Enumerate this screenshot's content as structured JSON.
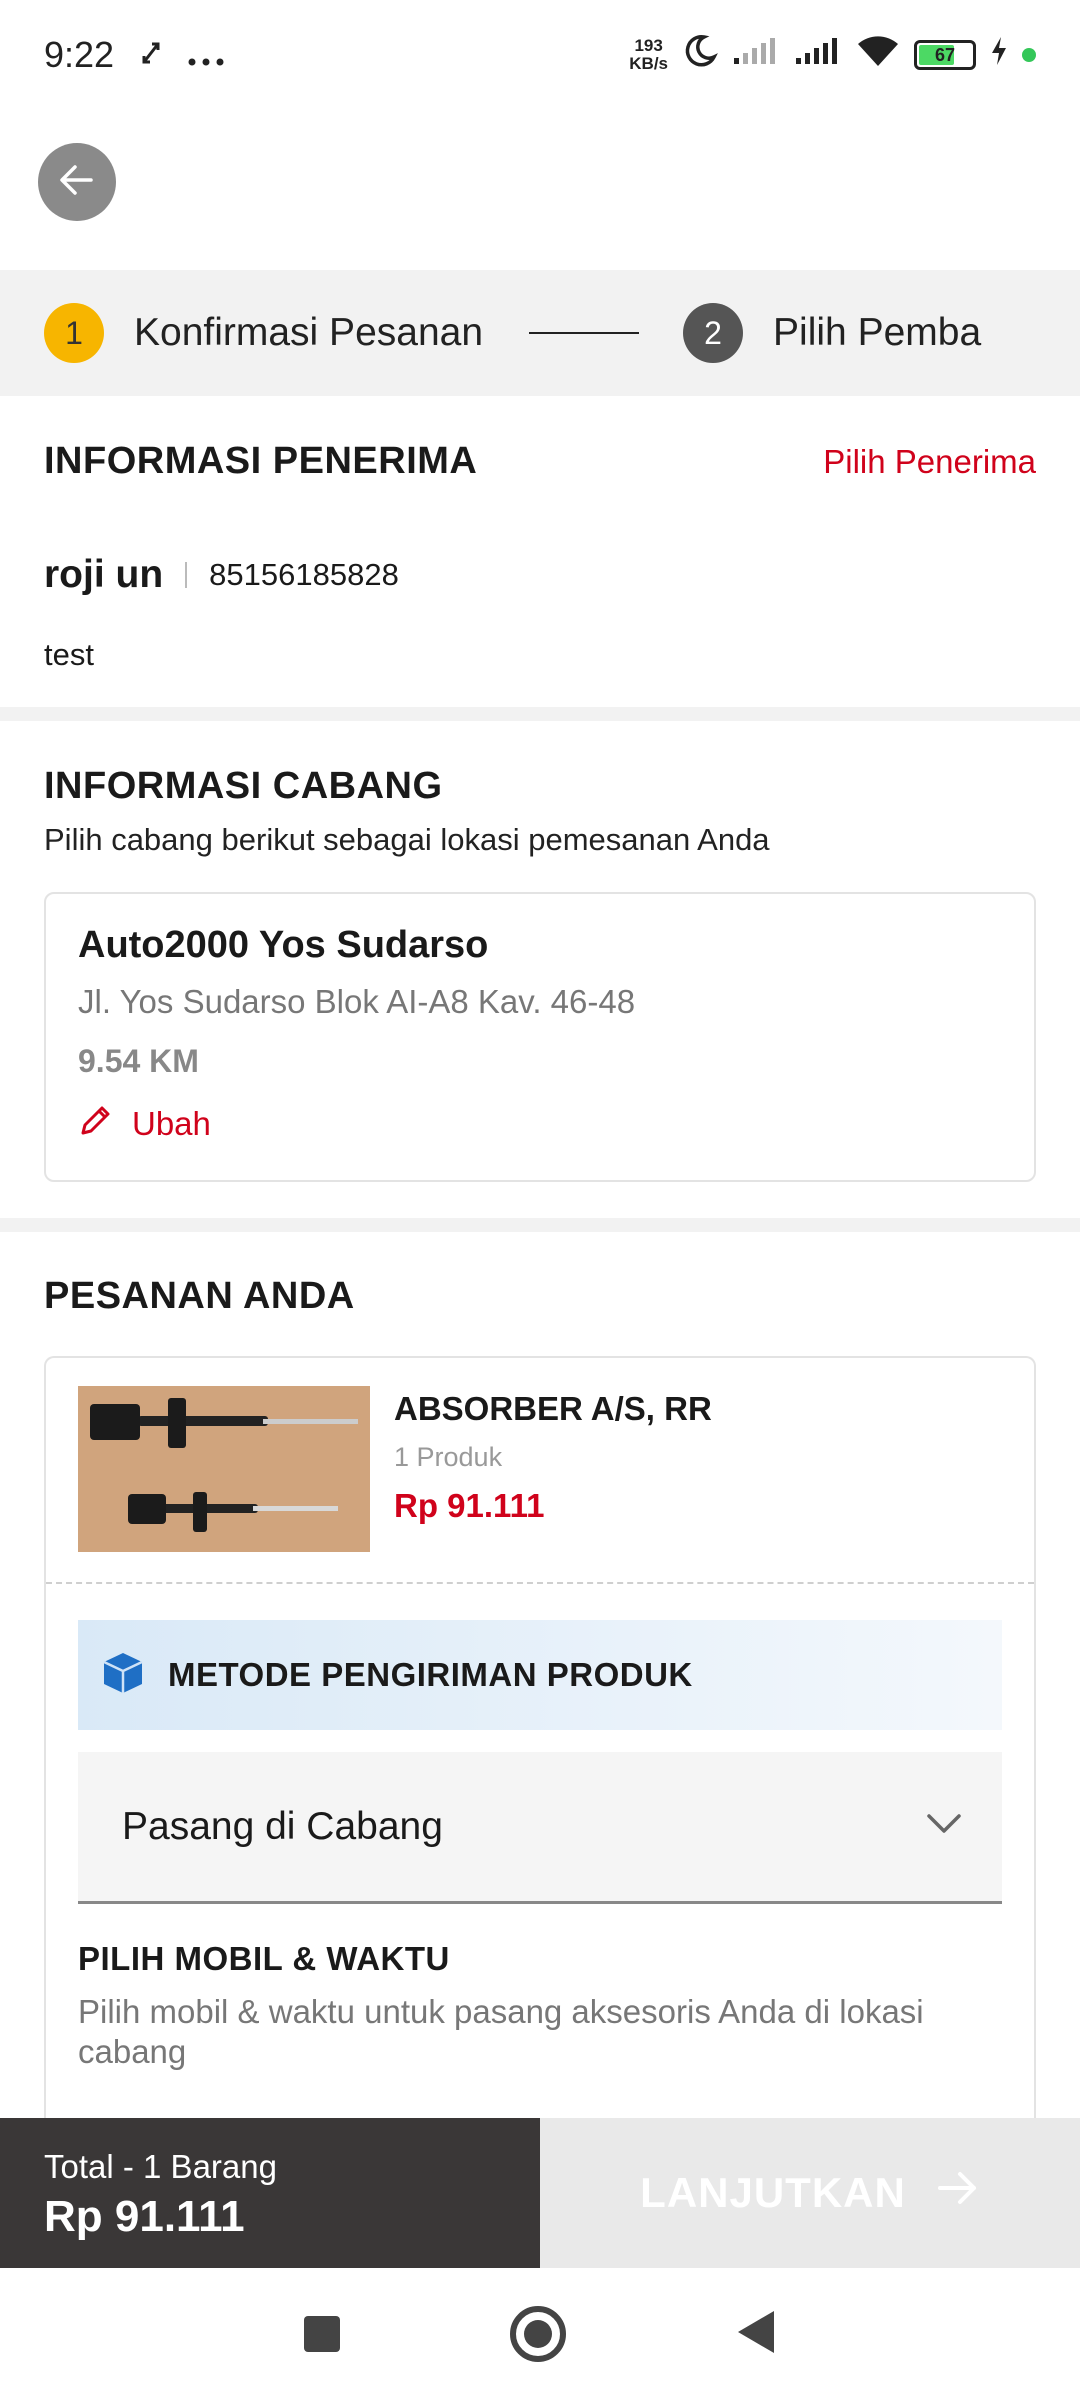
{
  "status_bar": {
    "time": "9:22",
    "speed_value": "193",
    "speed_unit": "KB/s",
    "battery": "67",
    "icons": [
      "rotate-icon",
      "more-icon",
      "moon-icon",
      "signal-icon",
      "signal-icon",
      "wifi-icon",
      "battery-icon",
      "charging-icon"
    ]
  },
  "stepper": {
    "steps": [
      {
        "number": "1",
        "label": "Konfirmasi Pesanan"
      },
      {
        "number": "2",
        "label": "Pilih Pemba"
      }
    ]
  },
  "receiver": {
    "title": "INFORMASI PENERIMA",
    "action": "Pilih Penerima",
    "name": "roji un",
    "phone": "85156185828",
    "note": "test"
  },
  "branch": {
    "title": "INFORMASI CABANG",
    "subtitle": "Pilih cabang berikut sebagai lokasi pemesanan Anda",
    "name": "Auto2000 Yos Sudarso",
    "address": "Jl. Yos Sudarso Blok AI-A8 Kav. 46-48",
    "distance": "9.54 KM",
    "edit_label": "Ubah"
  },
  "order": {
    "title": "PESANAN ANDA",
    "product": {
      "name": "ABSORBER A/S, RR",
      "qty": "1 Produk",
      "price": "Rp 91.111"
    },
    "shipping": {
      "title": "METODE PENGIRIMAN PRODUK",
      "selected": "Pasang di Cabang"
    },
    "pick": {
      "title": "PILIH MOBIL & WAKTU",
      "description": "Pilih mobil & waktu untuk pasang aksesoris Anda di lokasi cabang"
    }
  },
  "footer": {
    "total_label": "Total - 1 Barang",
    "total_value": "Rp 91.111",
    "cta_label": "LANJUTKAN"
  },
  "colors": {
    "accent_red": "#d0021b",
    "step_active": "#f7b500",
    "footer_dark": "#3a3737"
  }
}
